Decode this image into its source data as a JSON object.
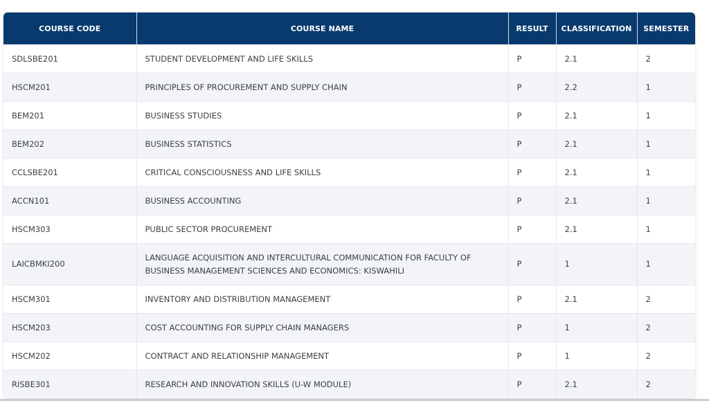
{
  "table": {
    "headers": [
      "COURSE CODE",
      "COURSE NAME",
      "RESULT",
      "CLASSIFICATION",
      "SEMESTER"
    ],
    "rows": [
      [
        "SDLSBE201",
        "STUDENT DEVELOPMENT AND LIFE SKILLS",
        "P",
        "2.1",
        "2"
      ],
      [
        "HSCM201",
        "PRINCIPLES OF PROCUREMENT AND SUPPLY CHAIN",
        "P",
        "2.2",
        "1"
      ],
      [
        "BEM201",
        "BUSINESS STUDIES",
        "P",
        "2.1",
        "1"
      ],
      [
        "BEM202",
        "BUSINESS STATISTICS",
        "P",
        "2.1",
        "1"
      ],
      [
        "CCLSBE201",
        "CRITICAL CONSCIOUSNESS AND LIFE SKILLS",
        "P",
        "2.1",
        "1"
      ],
      [
        "ACCN101",
        "BUSINESS ACCOUNTING",
        "P",
        "2.1",
        "1"
      ],
      [
        "HSCM303",
        "PUBLIC SECTOR PROCUREMENT",
        "P",
        "2.1",
        "1"
      ],
      [
        "LAICBMKI200",
        "LANGUAGE ACQUISITION AND INTERCULTURAL COMMUNICATION FOR FACULTY OF BUSINESS MANAGEMENT SCIENCES AND ECONOMICS: KISWAHILI",
        "P",
        "1",
        "1"
      ],
      [
        "HSCM301",
        "INVENTORY AND DISTRIBUTION MANAGEMENT",
        "P",
        "2.1",
        "2"
      ],
      [
        "HSCM203",
        "COST ACCOUNTING FOR SUPPLY CHAIN MANAGERS",
        "P",
        "1",
        "2"
      ],
      [
        "HSCM202",
        "CONTRACT AND RELATIONSHIP MANAGEMENT",
        "P",
        "1",
        "2"
      ],
      [
        "RISBE301",
        "RESEARCH AND INNOVATION SKILLS (U-W MODULE)",
        "P",
        "2.1",
        "2"
      ]
    ]
  },
  "colors": {
    "header_bg": "#083a6e",
    "header_text": "#ffffff",
    "row_alt_bg": "#f2f4f8",
    "cell_text": "#3a3f45"
  }
}
